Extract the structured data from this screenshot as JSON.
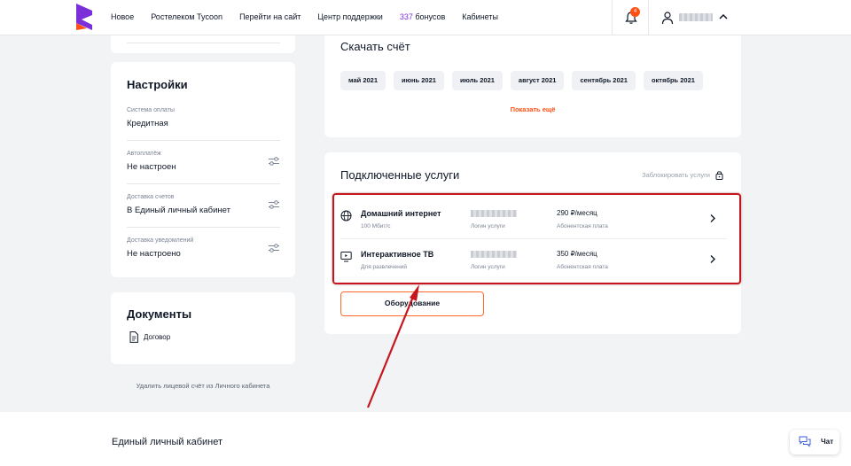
{
  "nav": {
    "items": [
      "Новое",
      "Ростелеком Tycoon",
      "Перейти на сайт",
      "Центр поддержки"
    ],
    "bonus_count": "337",
    "bonus_label": "бонусов",
    "cabinets": "Кабинеты",
    "notifications_count": "4"
  },
  "settings": {
    "title": "Настройки",
    "rows": [
      {
        "label": "Система оплаты",
        "value": "Кредитная"
      },
      {
        "label": "Автоплатёж",
        "value": "Не настроен"
      },
      {
        "label": "Доставка счетов",
        "value": "В Единый личный кабинет"
      },
      {
        "label": "Доставка уведомлений",
        "value": "Не настроено"
      }
    ]
  },
  "documents": {
    "title": "Документы",
    "items": [
      "Договор"
    ]
  },
  "delete_account_link": "Удалить лицевой счёт из Личного кабинета",
  "invoice": {
    "title": "Скачать счёт",
    "months": [
      "май 2021",
      "июнь 2021",
      "июль 2021",
      "август 2021",
      "сентябрь 2021",
      "октябрь 2021"
    ],
    "show_more": "Показать ещё"
  },
  "services": {
    "title": "Подключенные услуги",
    "block_link": "Заблокировать услуги",
    "items": [
      {
        "icon": "globe-icon",
        "name": "Домашний интернет",
        "sub": "100 Мбит/с",
        "login_label": "Логин услуги",
        "price": "290 ₽/месяц",
        "price_label": "Абонентская плата"
      },
      {
        "icon": "tv-icon",
        "name": "Интерактивное ТВ",
        "sub": "Для развлечений",
        "login_label": "Логин услуги",
        "price": "350 ₽/месяц",
        "price_label": "Абонентская плата"
      }
    ],
    "equipment_button": "Оборудование"
  },
  "footer": {
    "title": "Единый личный кабинет"
  },
  "chat": {
    "label": "Чат"
  },
  "colors": {
    "accent": "#ff4f12",
    "brand_purple": "#7a2fd8",
    "highlight_red": "#c4171d"
  }
}
